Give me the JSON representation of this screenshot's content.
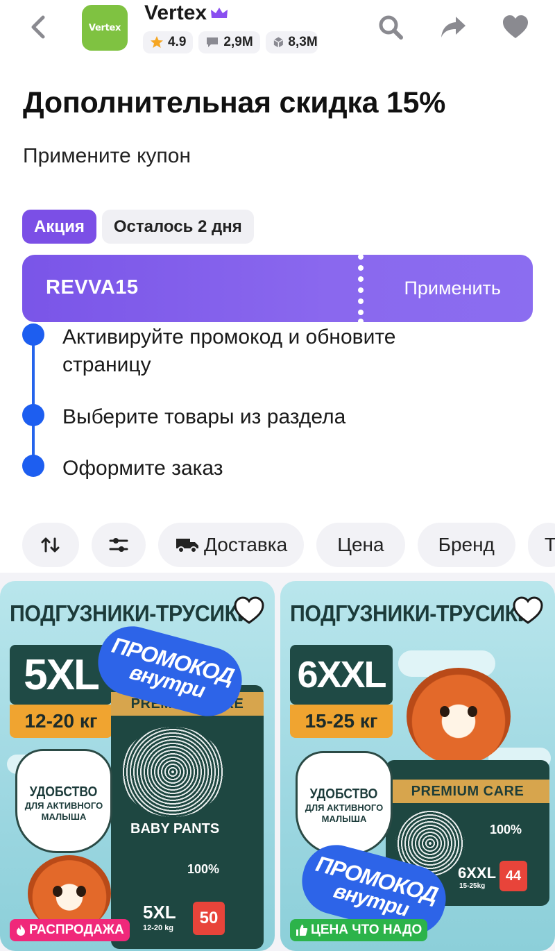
{
  "header": {
    "logo_text": "Vertex",
    "shop_name": "Vertex",
    "rating": "4.9",
    "reviews": "2,9M",
    "orders": "8,3M"
  },
  "promo": {
    "title": "Дополнительная скидка 15%",
    "subtitle": "Примените купон",
    "tag_label": "Акция",
    "days_left": "Осталось 2 дня",
    "coupon_code": "REVVA15",
    "apply_label": "Применить"
  },
  "steps": [
    "Активируйте промокод и обновите страницу",
    "Выберите товары из раздела",
    "Оформите заказ"
  ],
  "filters": {
    "delivery": "Доставка",
    "price": "Цена",
    "brand": "Бренд",
    "more": "Ти"
  },
  "products": [
    {
      "title": "ПОДГУЗНИКИ-ТРУСИКИ",
      "size": "5XL",
      "weight": "12-20 кг",
      "promo_l1": "ПРОМОКОД",
      "promo_l2": "внутри",
      "comfort_l1": "УДОБСТВО",
      "comfort_l2": "ДЛЯ АКТИВНОГО МАЛЫША",
      "pack_brand": "PREMIUM CARE",
      "pack_name": "BABY PANTS",
      "pack_size": "5XL",
      "pack_weight": "12-20 kg",
      "pack_count": "50",
      "pack_leak": "100%",
      "badge": "РАСПРОДАЖА",
      "badge_color": "#f0287a"
    },
    {
      "title": "ПОДГУЗНИКИ-ТРУСИКИ",
      "size": "6XXL",
      "weight": "15-25 кг",
      "promo_l1": "ПРОМОКОД",
      "promo_l2": "внутри",
      "comfort_l1": "УДОБСТВО",
      "comfort_l2": "ДЛЯ АКТИВНОГО МАЛЫША",
      "pack_brand": "PREMIUM CARE",
      "pack_size": "6XXL",
      "pack_weight": "15-25kg",
      "pack_count": "44",
      "pack_leak": "100%",
      "badge": "ЦЕНА ЧТО НАДО",
      "badge_color": "#2cb34a"
    }
  ],
  "colors": {
    "accent_purple": "#7b4fe6",
    "step_blue": "#1d5ef0",
    "logo_green": "#7fc241",
    "star": "#f5a623"
  }
}
